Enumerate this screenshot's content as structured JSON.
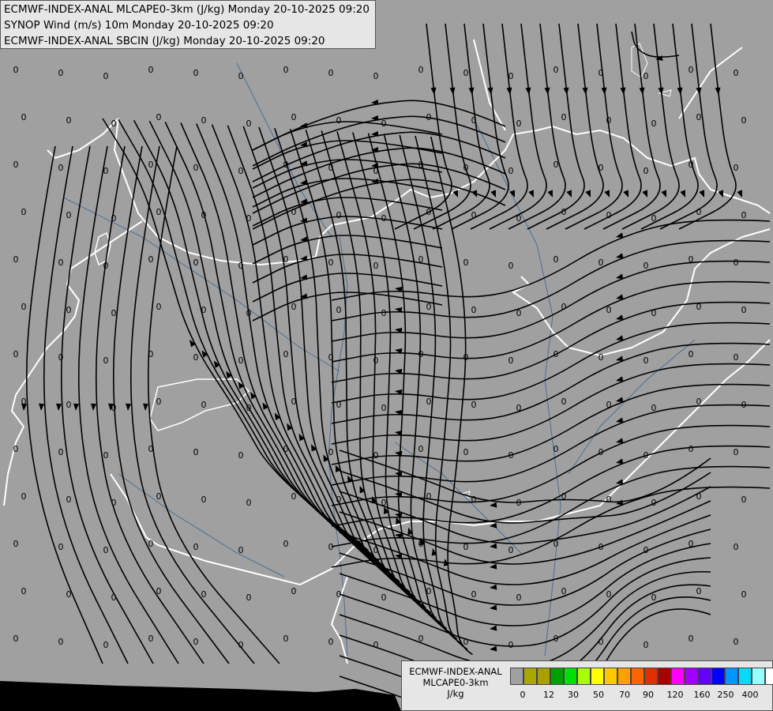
{
  "header": {
    "line1": "ECMWF-INDEX-ANAL MLCAPE0-3km (J/kg) Monday 20-10-2025 09:20",
    "line2": "SYNOP Wind (m/s) 10m Monday 20-10-2025 09:20",
    "line3": "ECMWF-INDEX-ANAL SBCIN (J/kg) Monday 20-10-2025 09:20"
  },
  "map": {
    "value_label": "0",
    "background_color": "#a0a0a0",
    "border_color": "#ffffff",
    "river_color": "#4a6f94",
    "streamline_color": "#000000"
  },
  "legend": {
    "line1": "ECMWF-INDEX-ANAL",
    "line2": "MLCAPE0-3km",
    "units": "J/kg",
    "colors": [
      "#a0a0a0",
      "#a8a800",
      "#a8a000",
      "#00a000",
      "#00e000",
      "#a8ff00",
      "#ffff00",
      "#ffc800",
      "#ffa000",
      "#ff6400",
      "#e03000",
      "#a80000",
      "#ff00ff",
      "#a000ff",
      "#6400ff",
      "#0000ff",
      "#0096ff",
      "#00dcff",
      "#96ffff",
      "#ffffff"
    ],
    "ticks": [
      "0",
      "12",
      "30",
      "50",
      "70",
      "90",
      "120",
      "160",
      "250",
      "400"
    ]
  }
}
